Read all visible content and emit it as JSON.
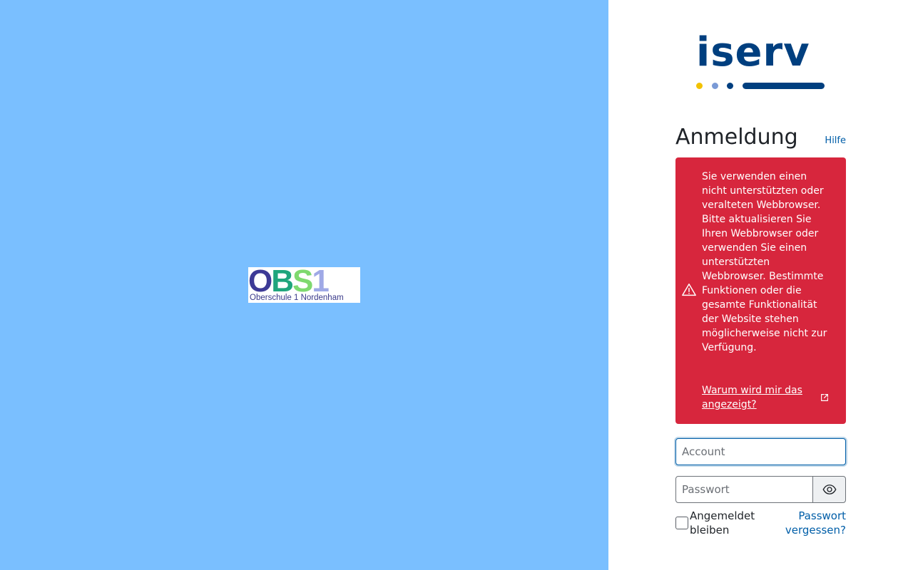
{
  "school_logo": {
    "letters": [
      "O",
      "B",
      "S",
      "1"
    ],
    "letter_colors": [
      "#3d3a96",
      "#1fa57c",
      "#7ed96f",
      "#9fa9e6"
    ],
    "subtitle": "Oberschule 1 Nordenham"
  },
  "brand": {
    "logo_text": "iserv",
    "primary_color": "#003f7f",
    "dot_colors": [
      "#f2c200",
      "#7a9ad6",
      "#003f7f"
    ]
  },
  "login": {
    "title": "Anmeldung",
    "help_link": "Hilfe",
    "alert": {
      "icon": "warning-triangle-icon",
      "background_color": "#d7263d",
      "text": "Sie verwenden einen nicht unterstützten oder veralteten Webbrowser. Bitte aktualisieren Sie Ihren Webbrowser oder verwenden Sie einen unterstützten Webbrowser. Bestimmte Funktionen oder die gesamte Funktionalität der Website stehen möglicherweise nicht zur Verfügung.",
      "link_text": "Warum wird mir das angezeigt?",
      "link_icon": "external-link-icon"
    },
    "account_placeholder": "Account",
    "account_value": "",
    "password_placeholder": "Passwort",
    "password_value": "",
    "show_password_icon": "eye-icon",
    "remember_label": "Angemeldet bleiben",
    "remember_checked": false,
    "forgot_link": "Passwort vergessen?"
  }
}
